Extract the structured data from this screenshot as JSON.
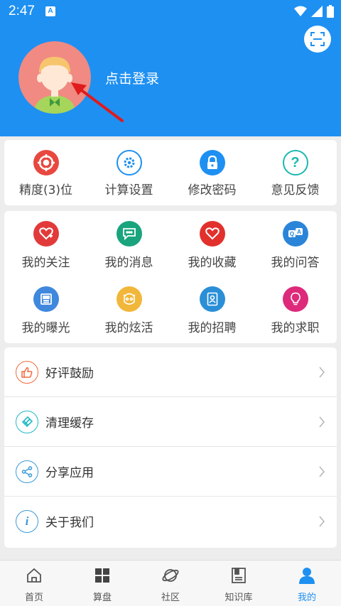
{
  "status": {
    "time": "2:47",
    "notif": "A"
  },
  "header": {
    "login_text": "点击登录"
  },
  "tools": [
    {
      "label": "精度(3)位",
      "icon": "target-icon",
      "color": "#e8483f"
    },
    {
      "label": "计算设置",
      "icon": "gear-icon",
      "color": "#1e90f2"
    },
    {
      "label": "修改密码",
      "icon": "lock-icon",
      "color": "#1e90f2"
    },
    {
      "label": "意见反馈",
      "icon": "question-icon",
      "color": "#1bb9b0"
    }
  ],
  "mine": [
    {
      "label": "我的关注",
      "icon": "heart-plus-icon",
      "color": "#e23a3a"
    },
    {
      "label": "我的消息",
      "icon": "chat-icon",
      "color": "#1aa47e"
    },
    {
      "label": "我的收藏",
      "icon": "heart-icon",
      "color": "#e2302c"
    },
    {
      "label": "我的问答",
      "icon": "qa-icon",
      "color": "#2a85d8"
    },
    {
      "label": "我的曝光",
      "icon": "newspaper-icon",
      "color": "#3f88dd"
    },
    {
      "label": "我的炫活",
      "icon": "face-icon",
      "color": "#f1b73a"
    },
    {
      "label": "我的招聘",
      "icon": "id-card-icon",
      "color": "#2a8fd6"
    },
    {
      "label": "我的求职",
      "icon": "bulb-icon",
      "color": "#dd2a7b"
    }
  ],
  "menu": [
    {
      "label": "好评鼓励",
      "icon": "thumbs-up-icon",
      "color": "#f26a3c"
    },
    {
      "label": "清理缓存",
      "icon": "broom-icon",
      "color": "#20b8c4"
    },
    {
      "label": "分享应用",
      "icon": "share-icon",
      "color": "#3a9ad9"
    },
    {
      "label": "关于我们",
      "icon": "info-icon",
      "color": "#3a9ad9"
    }
  ],
  "nav": [
    {
      "label": "首页",
      "icon": "home-icon",
      "active": false
    },
    {
      "label": "算盘",
      "icon": "grid-icon",
      "active": false
    },
    {
      "label": "社区",
      "icon": "planet-icon",
      "active": false
    },
    {
      "label": "知识库",
      "icon": "book-icon",
      "active": false
    },
    {
      "label": "我的",
      "icon": "user-icon",
      "active": true
    }
  ],
  "colors": {
    "primary": "#1e90f2",
    "background": "#ededed"
  }
}
